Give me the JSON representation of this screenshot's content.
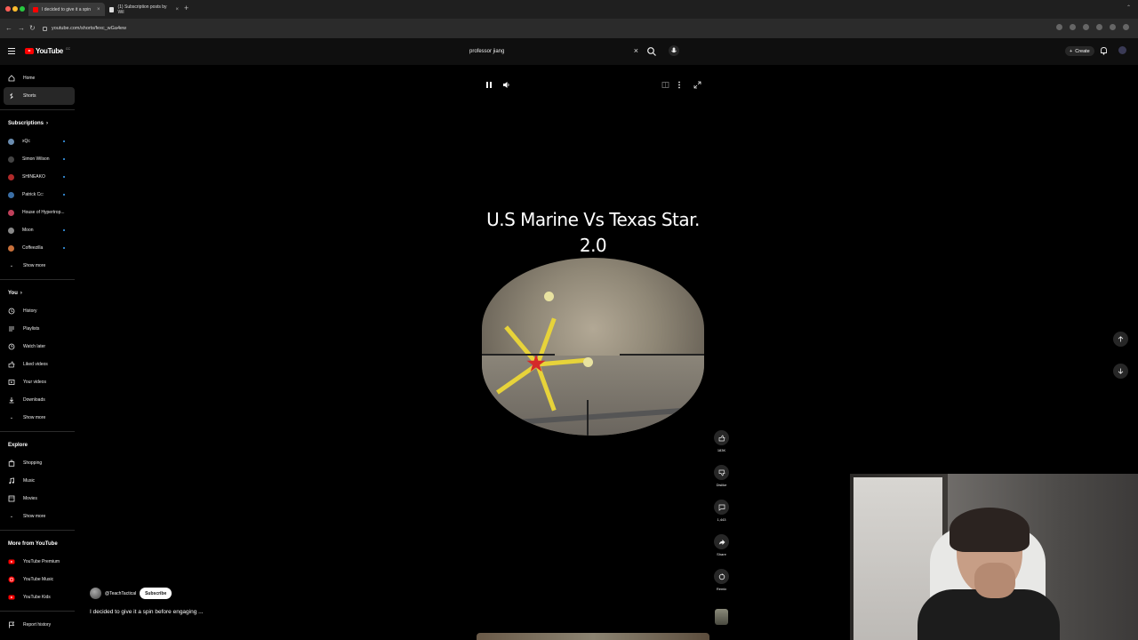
{
  "browser": {
    "tabs": [
      {
        "title": "I decided to give it a spin",
        "active": true,
        "favicon_color": "#ff0000"
      },
      {
        "title": "(1) Subscription posts by Wil",
        "active": false,
        "favicon_color": "#dddddd"
      }
    ],
    "url": "youtube.com/shorts/fexc_wGa4ew"
  },
  "header": {
    "logo_text": "YouTube",
    "logo_country": "CC",
    "search_value": "professor jiang",
    "create_label": "Create"
  },
  "sidebar": {
    "main": [
      {
        "label": "Home",
        "icon": "home-icon"
      },
      {
        "label": "Shorts",
        "icon": "shorts-icon",
        "active": true
      }
    ],
    "subscriptions_title": "Subscriptions",
    "subscriptions": [
      {
        "label": "xQc",
        "color": "#6a8caf"
      },
      {
        "label": "Simon Wilson",
        "color": "#444444"
      },
      {
        "label": "SHINEAKO",
        "color": "#b02a2a"
      },
      {
        "label": "Patrick Cc:",
        "color": "#3a6ea5"
      },
      {
        "label": "House of Hypertrop...",
        "color": "#c0405a"
      },
      {
        "label": "Moon",
        "color": "#888888"
      },
      {
        "label": "Coffeezilla",
        "color": "#c8703a"
      }
    ],
    "show_more_1": "Show more",
    "you_title": "You",
    "you": [
      {
        "label": "History",
        "icon": "history-icon"
      },
      {
        "label": "Playlists",
        "icon": "playlists-icon"
      },
      {
        "label": "Watch later",
        "icon": "clock-icon"
      },
      {
        "label": "Liked videos",
        "icon": "like-icon"
      },
      {
        "label": "Your videos",
        "icon": "video-icon"
      },
      {
        "label": "Downloads",
        "icon": "download-icon"
      }
    ],
    "show_more_2": "Show more",
    "explore_title": "Explore",
    "explore": [
      {
        "label": "Shopping",
        "icon": "bag-icon"
      },
      {
        "label": "Music",
        "icon": "music-icon"
      },
      {
        "label": "Movies",
        "icon": "film-icon"
      }
    ],
    "show_more_3": "Show more",
    "more_title": "More from YouTube",
    "more": [
      {
        "label": "YouTube Premium"
      },
      {
        "label": "YouTube Music"
      },
      {
        "label": "YouTube Kids"
      }
    ],
    "report": "Report history"
  },
  "video": {
    "title_line1": "U.S Marine Vs Texas Star.",
    "title_line2": "2.0",
    "channel": "@TeachTactical",
    "subscribe_label": "Subscribe",
    "caption": "I decided to give it a spin before engaging ..."
  },
  "actions": {
    "like_count": "183K",
    "dislike_label": "Dislike",
    "comment_count": "1,443",
    "share_label": "Share",
    "remix_label": "Remix"
  },
  "colors": {
    "accent": "#ff0000",
    "background": "#0f0f0f",
    "surface": "#272727",
    "dot": "#3ea6ff"
  }
}
